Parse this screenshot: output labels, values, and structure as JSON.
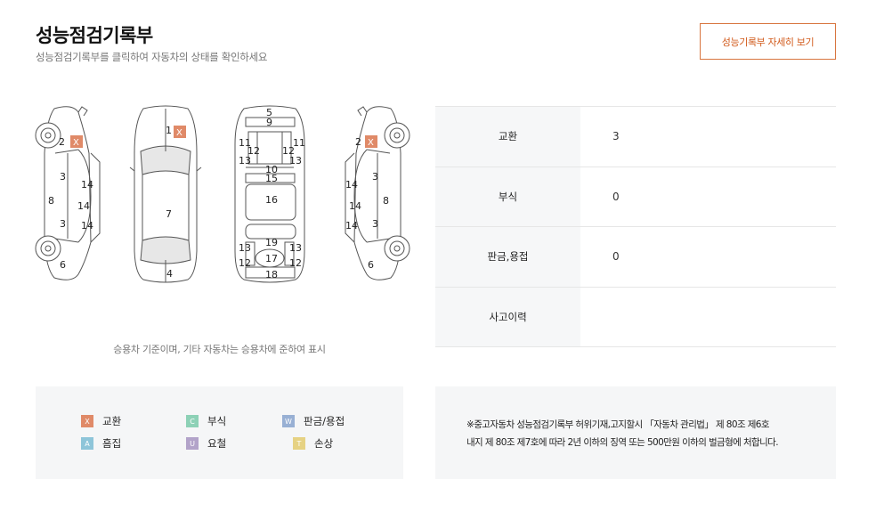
{
  "header": {
    "title": "성능점검기록부",
    "subtitle": "성능점검기록부를 클릭하여 자동차의 상태를 확인하세요",
    "detail_button": "성능기록부 자세히 보기"
  },
  "diagram": {
    "note": "승용차 기준이며, 기타 자동차는 승용차에 준하여 표시",
    "mark_symbol": "X",
    "left_side": [
      "2",
      "3",
      "8",
      "3",
      "6",
      "14",
      "14",
      "14"
    ],
    "top_view": [
      "1",
      "7",
      "4"
    ],
    "under_view": [
      "5",
      "9",
      "11",
      "12",
      "12",
      "11",
      "13",
      "13",
      "10",
      "15",
      "16",
      "19",
      "13",
      "13",
      "12",
      "17",
      "12",
      "18"
    ],
    "right_side": [
      "2",
      "3",
      "8",
      "3",
      "6",
      "14",
      "14",
      "14"
    ]
  },
  "status": [
    {
      "label": "교환",
      "value": "3"
    },
    {
      "label": "부식",
      "value": "0"
    },
    {
      "label": "판금,용접",
      "value": "0"
    },
    {
      "label": "사고이력",
      "value": ""
    }
  ],
  "legend": [
    {
      "symbol": "X",
      "label": "교환",
      "color": "#e08a68"
    },
    {
      "symbol": "C",
      "label": "부식",
      "color": "#8dd1b6"
    },
    {
      "symbol": "W",
      "label": "판금/용접",
      "color": "#98b0d4"
    },
    {
      "symbol": "A",
      "label": "흠집",
      "color": "#8ec5d9"
    },
    {
      "symbol": "U",
      "label": "요철",
      "color": "#b2a3c9"
    },
    {
      "symbol": "T",
      "label": "손상",
      "color": "#e6d283"
    }
  ],
  "law_notice": {
    "line1": "※중고자동차 성능점검기록부 허위기재,고지할시 「자동차 관리법」 제 80조 제6호",
    "line2": "내지 제 80조 제7호에 따라 2년 이하의 징역 또는 500만원 이하의 벌금형에 처합니다."
  },
  "colors": {
    "accent": "#d25b1c",
    "exchange_mark": "#e08a68"
  }
}
